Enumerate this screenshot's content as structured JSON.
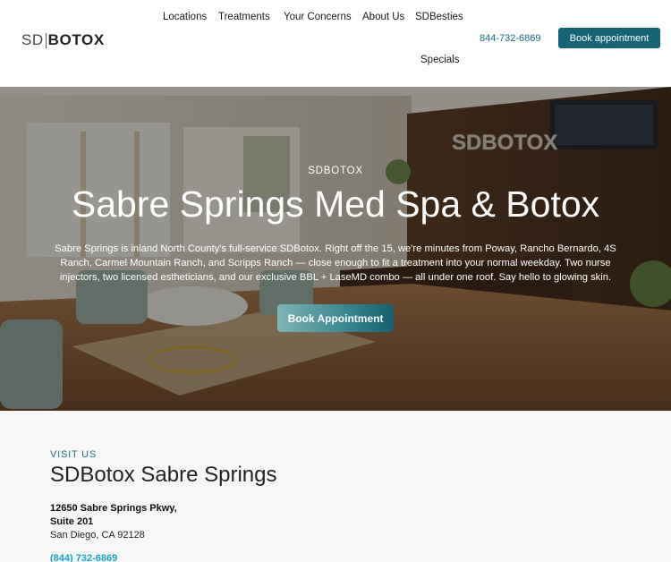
{
  "header": {
    "logo": {
      "sd": "SD",
      "botox": "BOTOX"
    },
    "nav": [
      {
        "label": "Locations"
      },
      {
        "label": "Treatments"
      },
      {
        "label": "Your Concerns"
      },
      {
        "label": "About Us"
      },
      {
        "label": "SDBesties"
      },
      {
        "label": "Specials"
      }
    ],
    "phone": "844-732-6869",
    "book_label": "Book appointment"
  },
  "hero": {
    "eyebrow": "SDBOTOX",
    "title": "Sabre Springs Med Spa & Botox",
    "description": "Sabre Springs is inland North County's full-service SDBotox. Right off the 15, we're minutes from Poway, Rancho Bernardo, 4S Ranch, Carmel Mountain Ranch, and Scripps Ranch — close enough to fit a treatment into your normal weekday. Two nurse injectors, two licensed estheticians, and our exclusive BBL + LaseMD combo — all under one roof. Say hello to glowing skin.",
    "cta_label": "Book Appointment",
    "wall_sign": "SDBOTOX"
  },
  "visit": {
    "eyebrow": "VISIT US",
    "title": "SDBotox Sabre Springs",
    "address_line1": "12650 Sabre Springs Pkwy,",
    "address_line2": "Suite 201",
    "address_line3": "San Diego, CA 92128",
    "phone": "(844) 732-6869"
  },
  "colors": {
    "brand_teal": "#156374",
    "phone_teal": "#1a6a7c",
    "link_blue": "#1aa3c7"
  }
}
